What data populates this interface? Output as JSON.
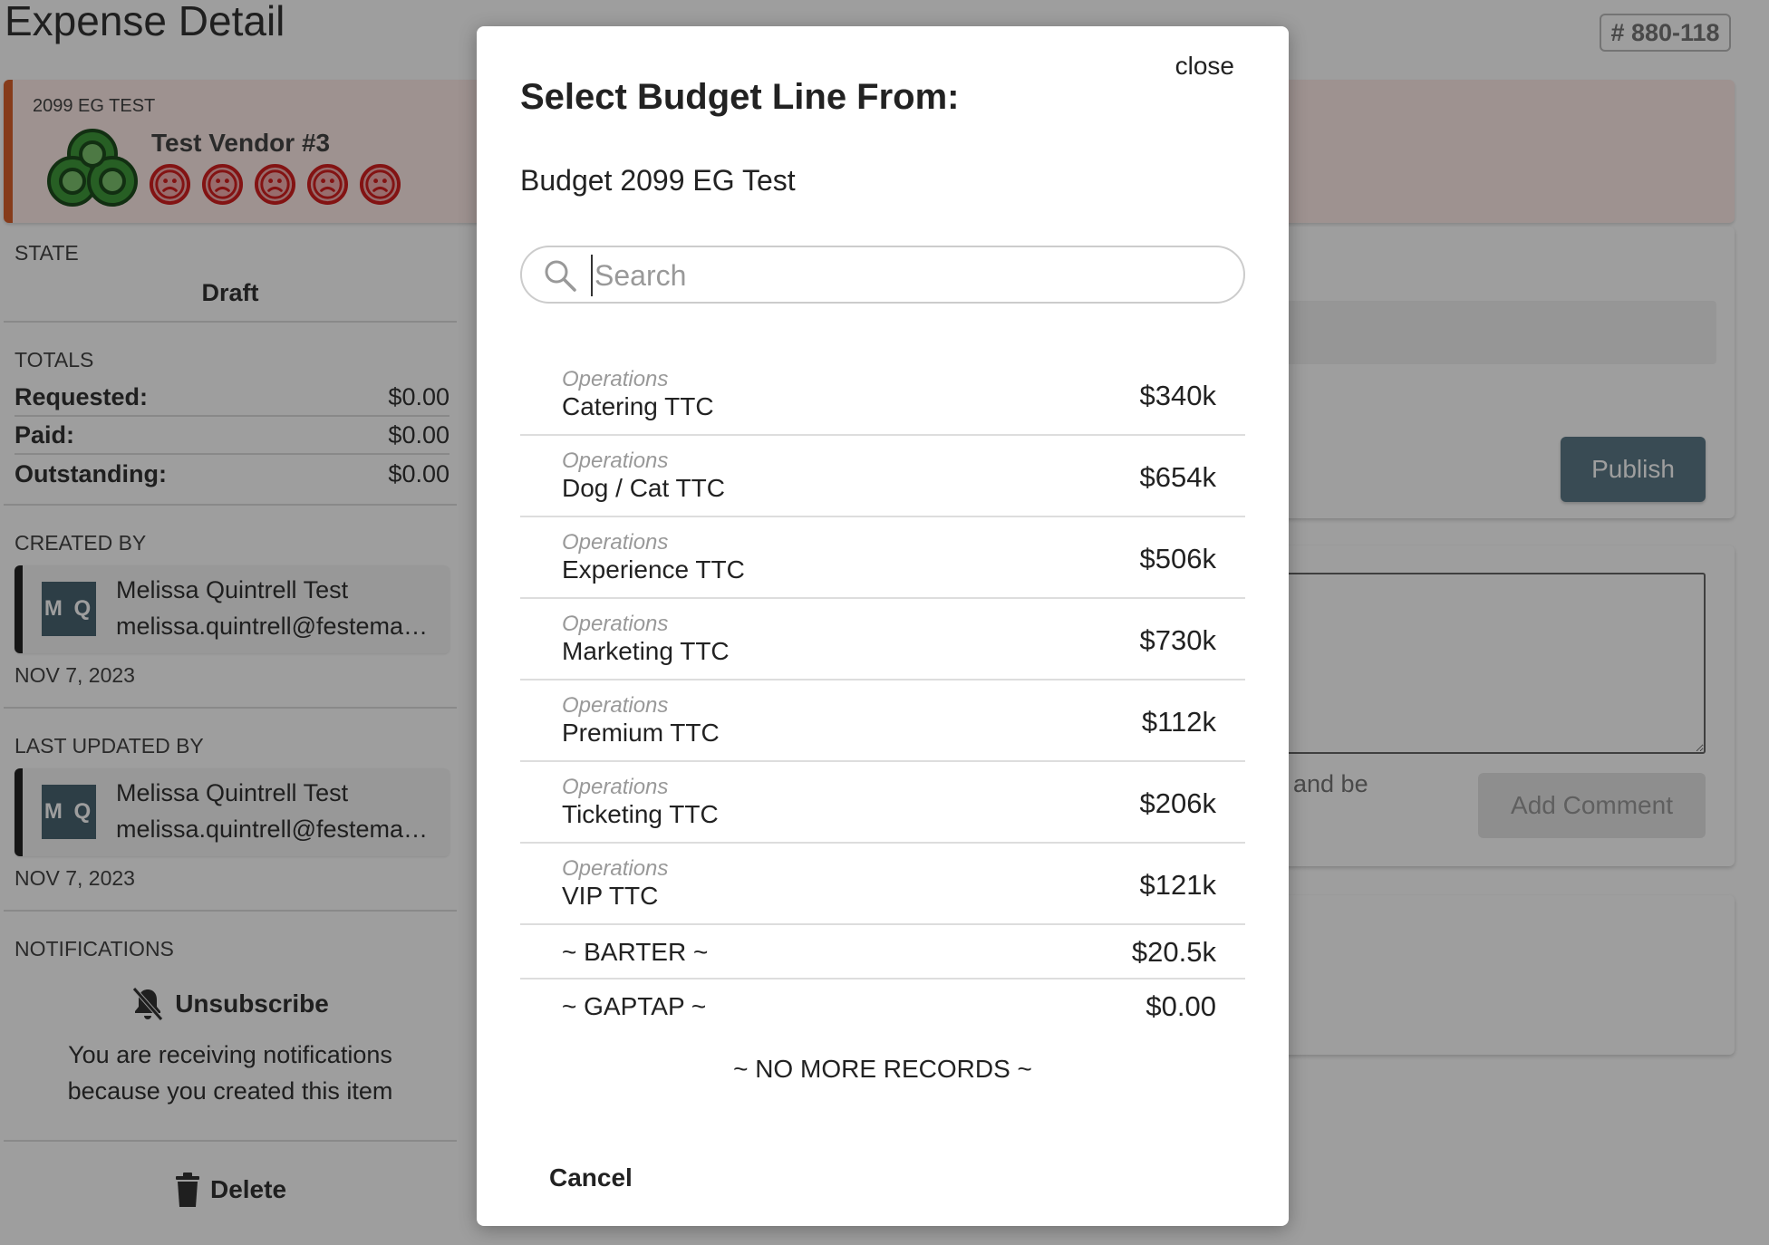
{
  "page": {
    "title": "Expense Detail",
    "id_badge": "# 880-118"
  },
  "vendor": {
    "event": "2099 EG TEST",
    "name": "Test Vendor #3",
    "rating_icon": "frown-face-icon",
    "rating_count": 5,
    "accent_color": "#d9602a"
  },
  "sidebar": {
    "state_label": "STATE",
    "state_value": "Draft",
    "totals_label": "TOTALS",
    "totals": [
      {
        "label": "Requested:",
        "value": "$0.00"
      },
      {
        "label": "Paid:",
        "value": "$0.00"
      },
      {
        "label": "Outstanding:",
        "value": "$0.00"
      }
    ],
    "created_by_label": "CREATED BY",
    "created_by": {
      "initials": "M Q",
      "name": "Melissa Quintrell Test",
      "email": "melissa.quintrell@festema…",
      "date": "NOV 7, 2023"
    },
    "updated_by_label": "LAST UPDATED BY",
    "updated_by": {
      "initials": "M Q",
      "name": "Melissa Quintrell Test",
      "email": "melissa.quintrell@festema…",
      "date": "NOV 7, 2023"
    },
    "notifications_label": "NOTIFICATIONS",
    "unsubscribe_label": "Unsubscribe",
    "notification_text": "You are receiving notifications because you created this item",
    "delete_label": "Delete"
  },
  "main": {
    "publish_label": "Publish",
    "comment_note": ", and be",
    "add_comment_label": "Add Comment"
  },
  "modal": {
    "close_label": "close",
    "title": "Select Budget Line From:",
    "subtitle": "Budget 2099 EG Test",
    "search_placeholder": "Search",
    "rows": [
      {
        "category": "Operations",
        "name": "Catering TTC",
        "amount": "$340k"
      },
      {
        "category": "Operations",
        "name": "Dog / Cat TTC",
        "amount": "$654k"
      },
      {
        "category": "Operations",
        "name": "Experience TTC",
        "amount": "$506k"
      },
      {
        "category": "Operations",
        "name": "Marketing TTC",
        "amount": "$730k"
      },
      {
        "category": "Operations",
        "name": "Premium TTC",
        "amount": "$112k"
      },
      {
        "category": "Operations",
        "name": "Ticketing TTC",
        "amount": "$206k"
      },
      {
        "category": "Operations",
        "name": "VIP TTC",
        "amount": "$121k"
      }
    ],
    "plain_rows": [
      {
        "name": "~ BARTER ~",
        "amount": "$20.5k"
      },
      {
        "name": "~ GAPTAP ~",
        "amount": "$0.00"
      }
    ],
    "end_text": "~ NO MORE RECORDS ~",
    "cancel_label": "Cancel"
  }
}
